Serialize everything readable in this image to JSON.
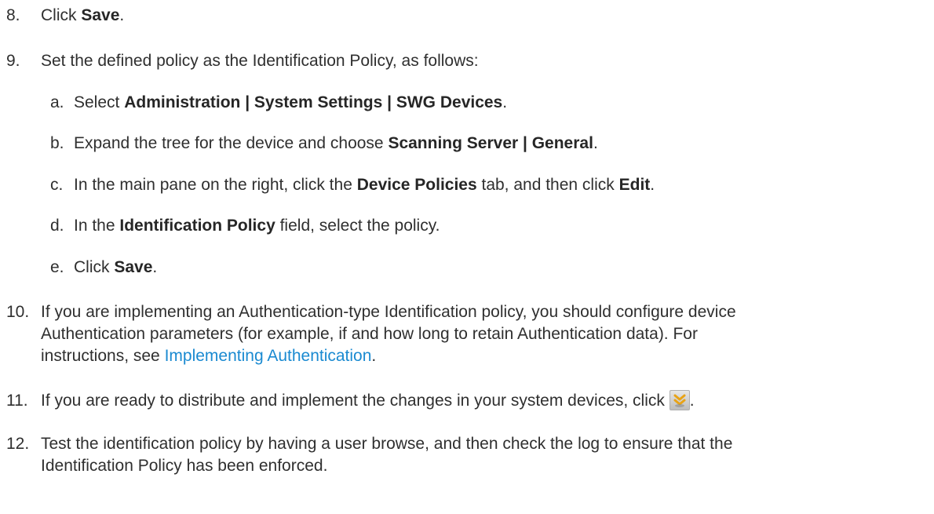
{
  "steps": {
    "s8": {
      "num": "8.",
      "pre": "Click ",
      "b1": "Save",
      "post": "."
    },
    "s9": {
      "num": "9.",
      "text": "Set the defined policy as the Identification Policy, as follows:",
      "sub": {
        "a": {
          "letter": "a.",
          "pre": "Select ",
          "b1": "Administration | System Settings | SWG Devices",
          "post": "."
        },
        "b": {
          "letter": "b.",
          "pre": "Expand the tree for the device and choose ",
          "b1": "Scanning Server | General",
          "post": "."
        },
        "c": {
          "letter": "c.",
          "pre": "In the main pane on the right, click the ",
          "b1": "Device Policies",
          "mid": " tab, and then click ",
          "b2": "Edit",
          "post": "."
        },
        "d": {
          "letter": "d.",
          "pre": "In the ",
          "b1": "Identification Policy",
          "post": " field, select the policy."
        },
        "e": {
          "letter": "e.",
          "pre": "Click ",
          "b1": "Save",
          "post": "."
        }
      }
    },
    "s10": {
      "num": "10.",
      "line1": "If you are implementing an Authentication-type Identification policy, you should configure device",
      "line2": "Authentication parameters (for example, if and how long to retain Authentication data). For",
      "line3_pre": "instructions, see ",
      "link": "Implementing Authentication",
      "line3_post": "."
    },
    "s11": {
      "num": "11.",
      "text": "If you are ready to distribute and implement the changes in your system devices, click ",
      "icon": "commit-changes-icon",
      "post": "."
    },
    "s12": {
      "num": "12.",
      "line1": "Test the identification policy by having a user browse, and then check the log to ensure that the",
      "line2": "Identification Policy has been enforced."
    }
  },
  "colors": {
    "text": "#2f2f2f",
    "link": "#1a8ad1",
    "icon_accent": "#e8a317"
  }
}
